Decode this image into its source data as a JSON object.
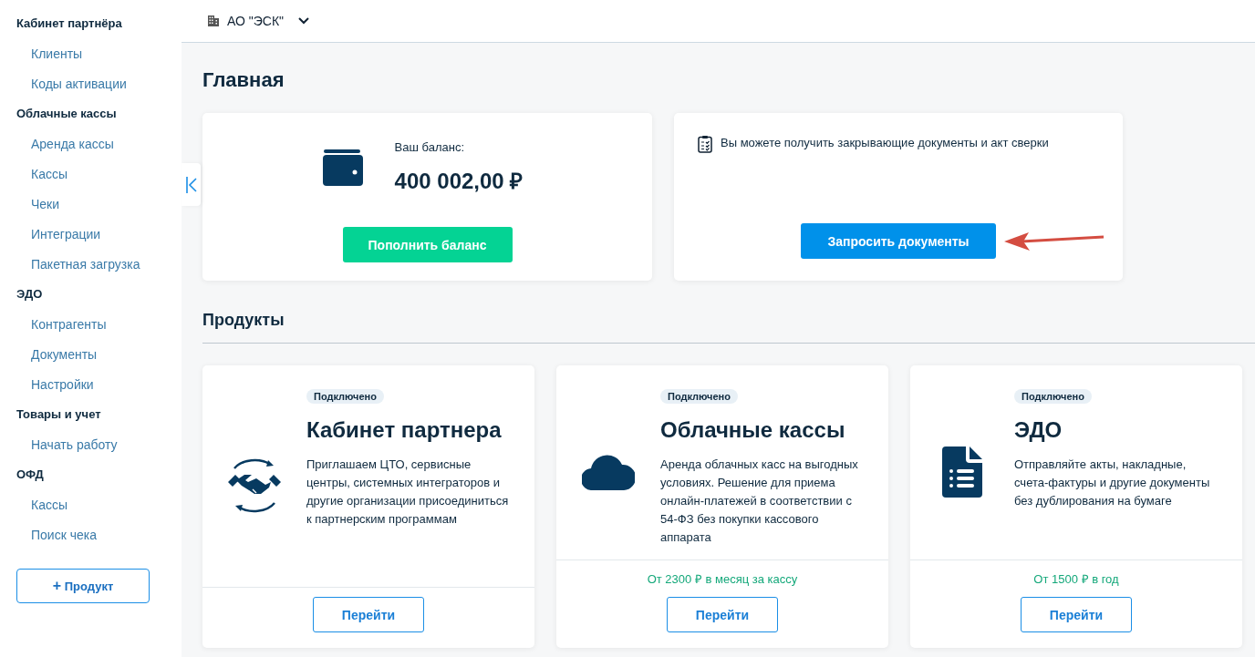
{
  "sidebar": {
    "sections": [
      {
        "label": "Кабинет партнёра",
        "children": [
          {
            "label": "Клиенты"
          },
          {
            "label": "Коды активации"
          }
        ]
      },
      {
        "label": "Облачные кассы",
        "children": [
          {
            "label": "Аренда кассы"
          },
          {
            "label": "Кассы"
          },
          {
            "label": "Чеки"
          },
          {
            "label": "Интеграции"
          },
          {
            "label": "Пакетная загрузка"
          }
        ]
      },
      {
        "label": "ЭДО",
        "children": [
          {
            "label": "Контрагенты"
          },
          {
            "label": "Документы"
          },
          {
            "label": "Настройки"
          }
        ]
      },
      {
        "label": "Товары и учет",
        "children": [
          {
            "label": "Начать работу"
          }
        ]
      },
      {
        "label": "ОФД",
        "children": [
          {
            "label": "Кассы"
          },
          {
            "label": "Поиск чека"
          }
        ]
      }
    ],
    "add_button": {
      "icon": "+",
      "label": "Продукт"
    }
  },
  "header": {
    "organization": "АО \"ЭСК\""
  },
  "page_title": "Главная",
  "balance_card": {
    "label": "Ваш баланс:",
    "amount": "400 002,00 ₽",
    "button": "Пополнить баланс"
  },
  "documents_card": {
    "text": "Вы можете получить закрывающие документы и акт сверки",
    "button": "Запросить документы"
  },
  "products_title": "Продукты",
  "products": [
    {
      "kind": "handshake",
      "status": "Подключено",
      "title": "Кабинет партнера",
      "description": "Приглашаем ЦТО, сервисные центры, системных интеграторов и другие организации присоединиться к партнерским программам",
      "button": "Перейти"
    },
    {
      "kind": "cloud",
      "status": "Подключено",
      "title": "Облачные кассы",
      "description": "Аренда облачных касс на выгодных условиях. Решение для приема онлайн-платежей в соответствии с 54-ФЗ без покупки кассового аппарата",
      "price": "От 2300 ₽ в месяц за кассу",
      "button": "Перейти"
    },
    {
      "kind": "document",
      "status": "Подключено",
      "title": "ЭДО",
      "description": "Отправляйте акты, накладные, счета-фактуры и другие документы без дублирования на бумаге",
      "price": "От 1500 ₽ в год",
      "button": "Перейти"
    }
  ]
}
